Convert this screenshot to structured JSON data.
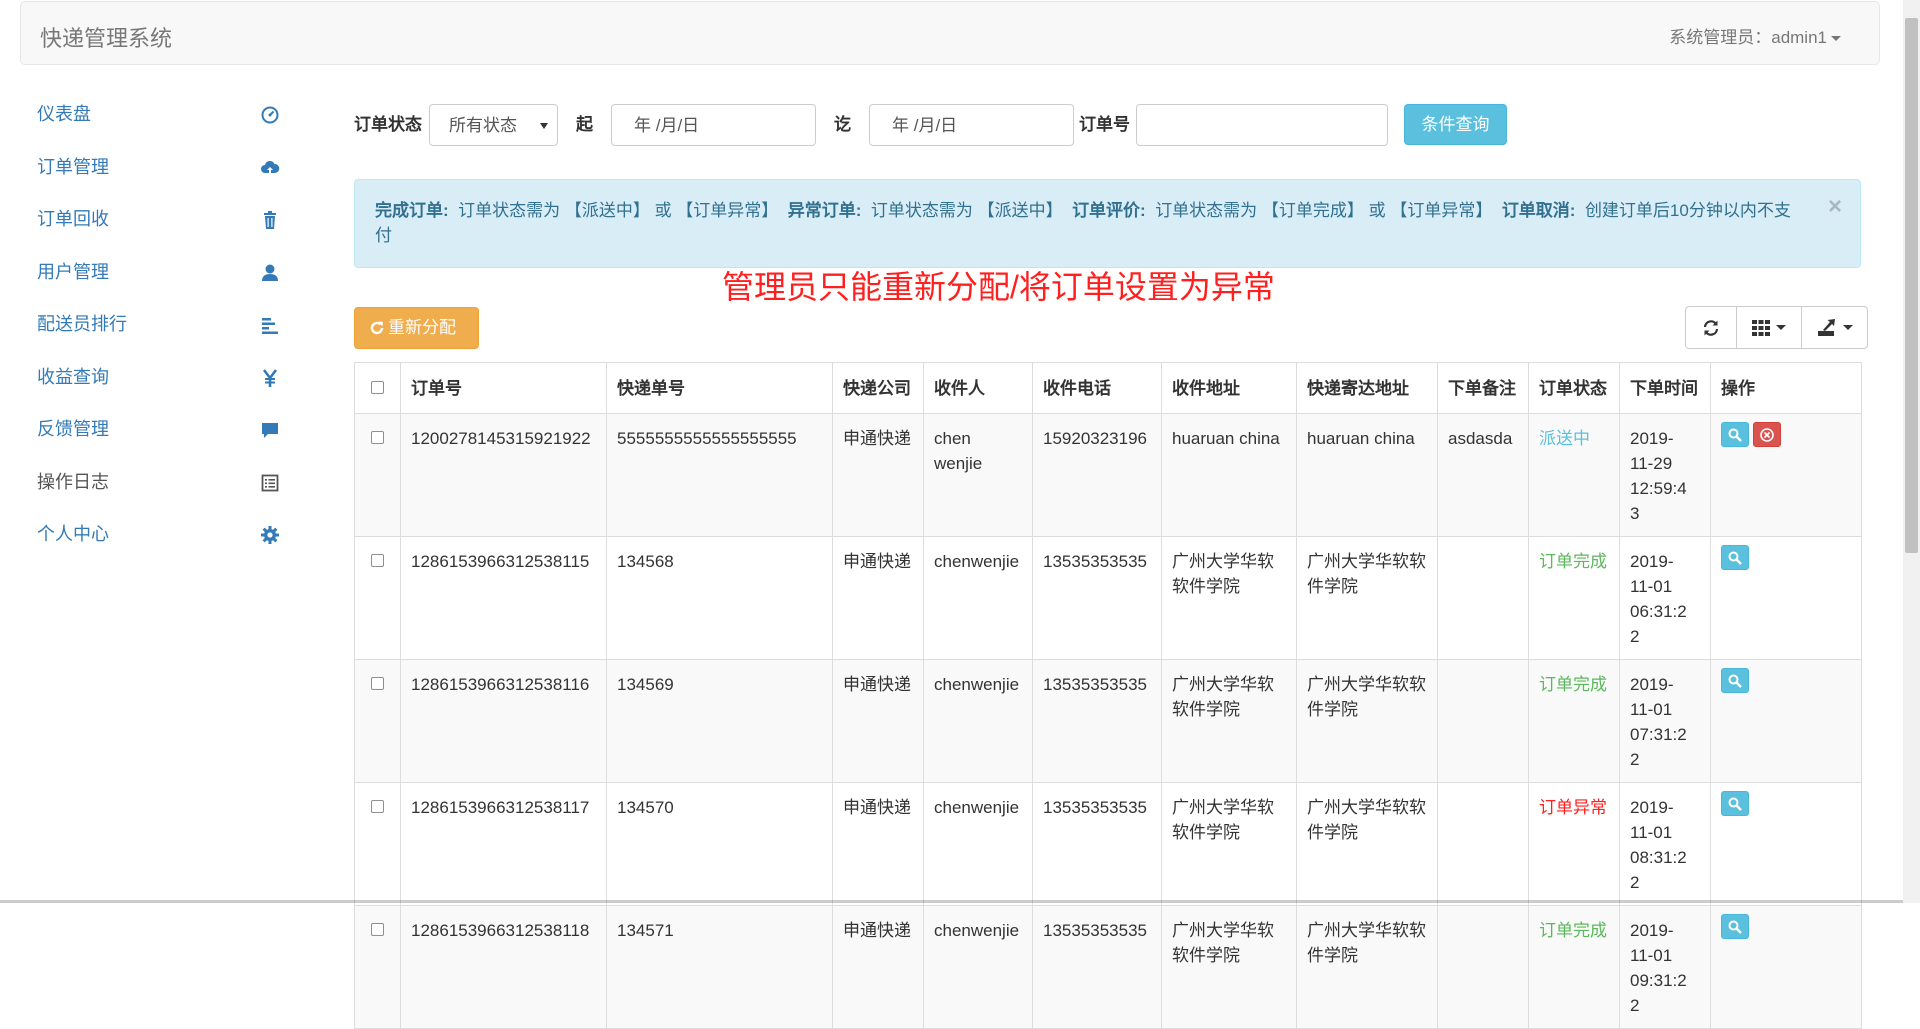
{
  "navbar": {
    "brand": "快递管理系统",
    "user_label": "系统管理员：admin1"
  },
  "sidebar": {
    "items": [
      {
        "label": "仪表盘",
        "icon": "dashboard-icon"
      },
      {
        "label": "订单管理",
        "icon": "cloud-upload-icon"
      },
      {
        "label": "订单回收",
        "icon": "trash-icon"
      },
      {
        "label": "用户管理",
        "icon": "user-icon"
      },
      {
        "label": "配送员排行",
        "icon": "bar-list-icon"
      },
      {
        "label": "收益查询",
        "icon": "yen-icon"
      },
      {
        "label": "反馈管理",
        "icon": "comment-icon"
      },
      {
        "label": "操作日志",
        "icon": "list-alt-icon"
      },
      {
        "label": "个人中心",
        "icon": "gear-icon"
      }
    ]
  },
  "filter": {
    "status_label": "订单状态",
    "status_value": "所有状态",
    "from_label": "起",
    "from_placeholder": "年 /月/日",
    "to_label": "讫",
    "to_placeholder": "年 /月/日",
    "order_no_label": "订单号",
    "order_no_value": "",
    "query_button": "条件查询"
  },
  "alert": {
    "items": [
      {
        "title": "完成订单:",
        "text": "订单状态需为 【派送中】 或 【订单异常】"
      },
      {
        "title": "异常订单:",
        "text": "订单状态需为 【派送中】"
      },
      {
        "title": "订单评价:",
        "text": "订单状态需为 【订单完成】 或 【订单异常】"
      },
      {
        "title": "订单取消:",
        "text": "创建订单后10分钟以内不支付"
      }
    ],
    "close": "×"
  },
  "annotation": "管理员只能重新分配/将订单设置为异常",
  "toolbar": {
    "reassign_label": "重新分配"
  },
  "table": {
    "headers": [
      "订单号",
      "快递单号",
      "快递公司",
      "收件人",
      "收件电话",
      "收件地址",
      "快递寄达地址",
      "下单备注",
      "订单状态",
      "下单时间",
      "操作"
    ],
    "rows": [
      {
        "order_no": "1200278145315921922",
        "tracking": "5555555555555555555",
        "company": "申通快递",
        "recipient": "chen wenjie",
        "phone": "15920323196",
        "address": "huaruan china",
        "dest": "huaruan china",
        "note": "asdasda",
        "status": "派送中",
        "status_color": "#5bc0de",
        "time": "2019-11-29 12:59:43",
        "can_delete": true
      },
      {
        "order_no": "1286153966312538115",
        "tracking": "134568",
        "company": "申通快递",
        "recipient": "chenwenjie",
        "phone": "13535353535",
        "address": "广州大学华软软件学院",
        "dest": "广州大学华软软件学院",
        "note": "",
        "status": "订单完成",
        "status_color": "#5cb85c",
        "time": "2019-11-01 06:31:22",
        "can_delete": false
      },
      {
        "order_no": "1286153966312538116",
        "tracking": "134569",
        "company": "申通快递",
        "recipient": "chenwenjie",
        "phone": "13535353535",
        "address": "广州大学华软软件学院",
        "dest": "广州大学华软软件学院",
        "note": "",
        "status": "订单完成",
        "status_color": "#5cb85c",
        "time": "2019-11-01 07:31:22",
        "can_delete": false
      },
      {
        "order_no": "1286153966312538117",
        "tracking": "134570",
        "company": "申通快递",
        "recipient": "chenwenjie",
        "phone": "13535353535",
        "address": "广州大学华软软件学院",
        "dest": "广州大学华软软件学院",
        "note": "",
        "status": "订单异常",
        "status_color": "#ff1f1f",
        "time": "2019-11-01 08:31:22",
        "can_delete": false
      },
      {
        "order_no": "1286153966312538118",
        "tracking": "134571",
        "company": "申通快递",
        "recipient": "chenwenjie",
        "phone": "13535353535",
        "address": "广州大学华软软件学院",
        "dest": "广州大学华软软件学院",
        "note": "",
        "status": "订单完成",
        "status_color": "#5cb85c",
        "time": "2019-11-01 09:31:22",
        "can_delete": false
      }
    ]
  }
}
